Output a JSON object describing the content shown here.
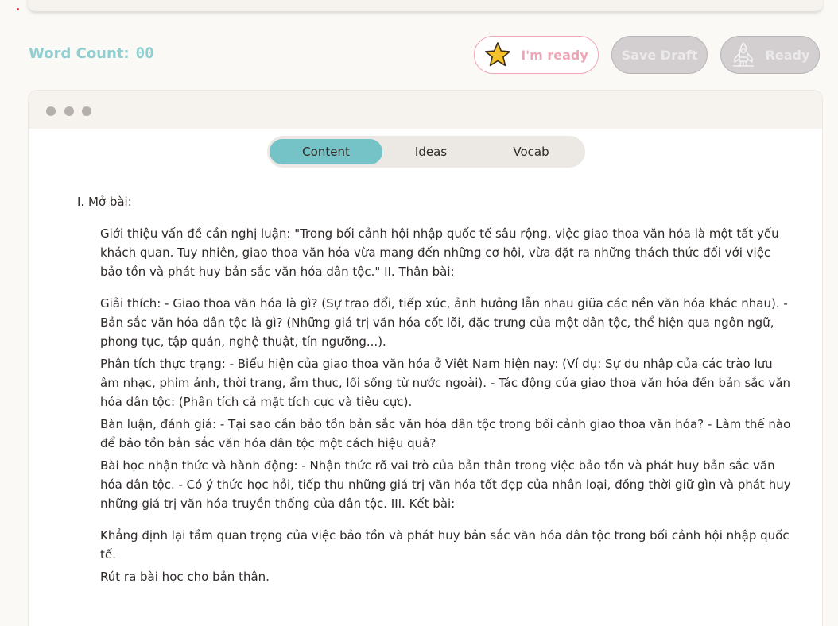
{
  "word_count": {
    "label": "Word Count:",
    "value": "00"
  },
  "buttons": {
    "im_ready": "I'm ready",
    "save_draft": "Save Draft",
    "ready": "Ready"
  },
  "tabs": [
    {
      "label": "Content",
      "active": true
    },
    {
      "label": "Ideas",
      "active": false
    },
    {
      "label": "Vocab",
      "active": false
    }
  ],
  "colors": {
    "accent_teal": "#75c2c7",
    "word_count": "#8fcfd1",
    "pink": "#f0a6b7",
    "disabled": "#d3cfd0"
  },
  "icons": {
    "im_ready": "star-icon",
    "ready": "rocket-icon"
  },
  "content": {
    "heading": "I. Mở bài:",
    "paragraphs": [
      "Giới thiệu vấn đề cần nghị luận: \"Trong bối cảnh hội nhập quốc tế sâu rộng, việc giao thoa văn hóa là một tất yếu khách quan. Tuy nhiên, giao thoa văn hóa vừa mang đến những cơ hội, vừa đặt ra những thách thức đối với việc bảo tồn và phát huy bản sắc văn hóa dân tộc.\" II. Thân bài:",
      "Giải thích: - Giao thoa văn hóa là gì? (Sự trao đổi, tiếp xúc, ảnh hưởng lẫn nhau giữa các nền văn hóa khác nhau). - Bản sắc văn hóa dân tộc là gì? (Những giá trị văn hóa cốt lõi, đặc trưng của một dân tộc, thể hiện qua ngôn ngữ, phong tục, tập quán, nghệ thuật, tín ngưỡng...).",
      "Phân tích thực trạng: - Biểu hiện của giao thoa văn hóa ở Việt Nam hiện nay: (Ví dụ: Sự du nhập của các trào lưu âm nhạc, phim ảnh, thời trang, ẩm thực, lối sống từ nước ngoài). - Tác động của giao thoa văn hóa đến bản sắc văn hóa dân tộc: (Phân tích cả mặt tích cực và tiêu cực).",
      "Bàn luận, đánh giá: - Tại sao cần bảo tồn bản sắc văn hóa dân tộc trong bối cảnh giao thoa văn hóa? - Làm thế nào để bảo tồn bản sắc văn hóa dân tộc một cách hiệu quả?",
      "Bài học nhận thức và hành động: - Nhận thức rõ vai trò của bản thân trong việc bảo tồn và phát huy bản sắc văn hóa dân tộc. - Có ý thức học hỏi, tiếp thu những giá trị văn hóa tốt đẹp của nhân loại, đồng thời giữ gìn và phát huy những giá trị văn hóa truyền thống của dân tộc. III. Kết bài:",
      "Khẳng định lại tầm quan trọng của việc bảo tồn và phát huy bản sắc văn hóa dân tộc trong bối cảnh hội nhập quốc tế.",
      "Rút ra bài học cho bản thân."
    ]
  }
}
